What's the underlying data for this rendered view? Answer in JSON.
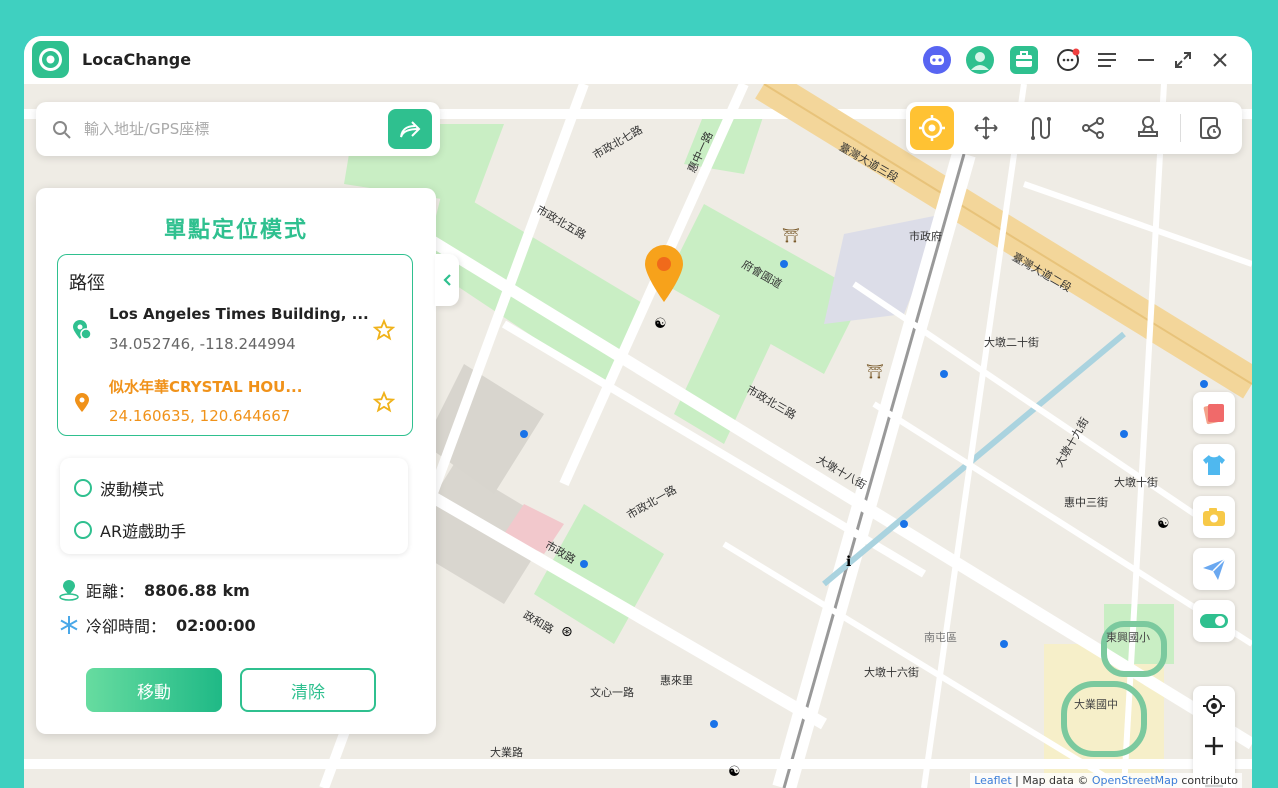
{
  "app": {
    "title": "LocaChange"
  },
  "search": {
    "placeholder": "輸入地址/GPS座標"
  },
  "panel": {
    "title": "單點定位模式",
    "route_label": "路徑",
    "origin": {
      "name": "Los Angeles Times Building, ...",
      "coord": "34.052746, -118.244994"
    },
    "destination": {
      "name": "似水年華CRYSTAL HOU...",
      "coord": "24.160635, 120.644667"
    },
    "options": {
      "wave": "波動模式",
      "ar": "AR遊戲助手"
    },
    "distance_label": "距離：",
    "distance_value": "8806.88 km",
    "cooldown_label": "冷卻時間：",
    "cooldown_value": "02:00:00",
    "move_button": "移動",
    "clear_button": "清除"
  },
  "map": {
    "streets": {
      "s1": "臺灣大道三段",
      "s2": "臺灣大道二段",
      "s3": "市政北七路",
      "s4": "惠中一路",
      "s5": "市政北五路",
      "s6": "府會園道",
      "s7": "市政北三路",
      "s8": "市政北一路",
      "s9": "市政路",
      "s10": "政和路",
      "s11": "惠來里",
      "s12": "文心一路",
      "s13": "市政府",
      "s14": "大墩十九街",
      "s15": "大墩十八街",
      "s16": "大墩十六街",
      "s17": "東興國小",
      "s18": "大業國中",
      "s19": "大業路",
      "s20": "南屯區",
      "s21": "大墩二十街",
      "s22": "惠中三街",
      "s23": "大墩十街"
    },
    "attribution": {
      "leaflet": "Leaflet",
      "sep": " | Map data © ",
      "osm": "OpenStreetMap",
      "contrib": " contributo"
    }
  },
  "colors": {
    "accent": "#2fc08f",
    "active_mode": "#ffc233",
    "orange": "#f0921a"
  }
}
